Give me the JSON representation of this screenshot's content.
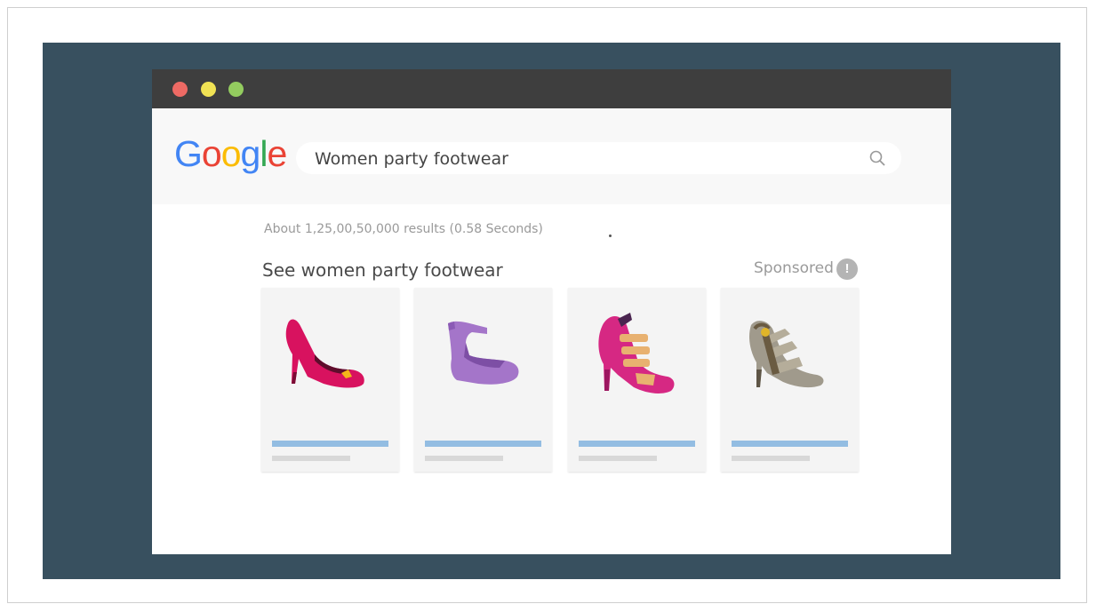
{
  "window": {
    "controls": [
      "close",
      "minimize",
      "maximize"
    ]
  },
  "search": {
    "logo_letters": [
      {
        "char": "G",
        "color": "#4285f4"
      },
      {
        "char": "o",
        "color": "#ea4335"
      },
      {
        "char": "o",
        "color": "#fbbc05"
      },
      {
        "char": "g",
        "color": "#4285f4"
      },
      {
        "char": "l",
        "color": "#34a853"
      },
      {
        "char": "e",
        "color": "#ea4335"
      }
    ],
    "query": "Women party footwear"
  },
  "results": {
    "count_text": "About 1,25,00,50,000 results (0.58 Seconds)"
  },
  "shopping": {
    "title": "See women party footwear",
    "sponsored_label": "Sponsored",
    "info_glyph": "!",
    "products": [
      {
        "icon": "red-pump-icon",
        "color": "#d8125f"
      },
      {
        "icon": "purple-wedge-icon",
        "color": "#a475c9"
      },
      {
        "icon": "pink-strappy-heel-icon",
        "color": "#d62883"
      },
      {
        "icon": "gray-cage-heel-icon",
        "color": "#a09a8c"
      }
    ]
  }
}
